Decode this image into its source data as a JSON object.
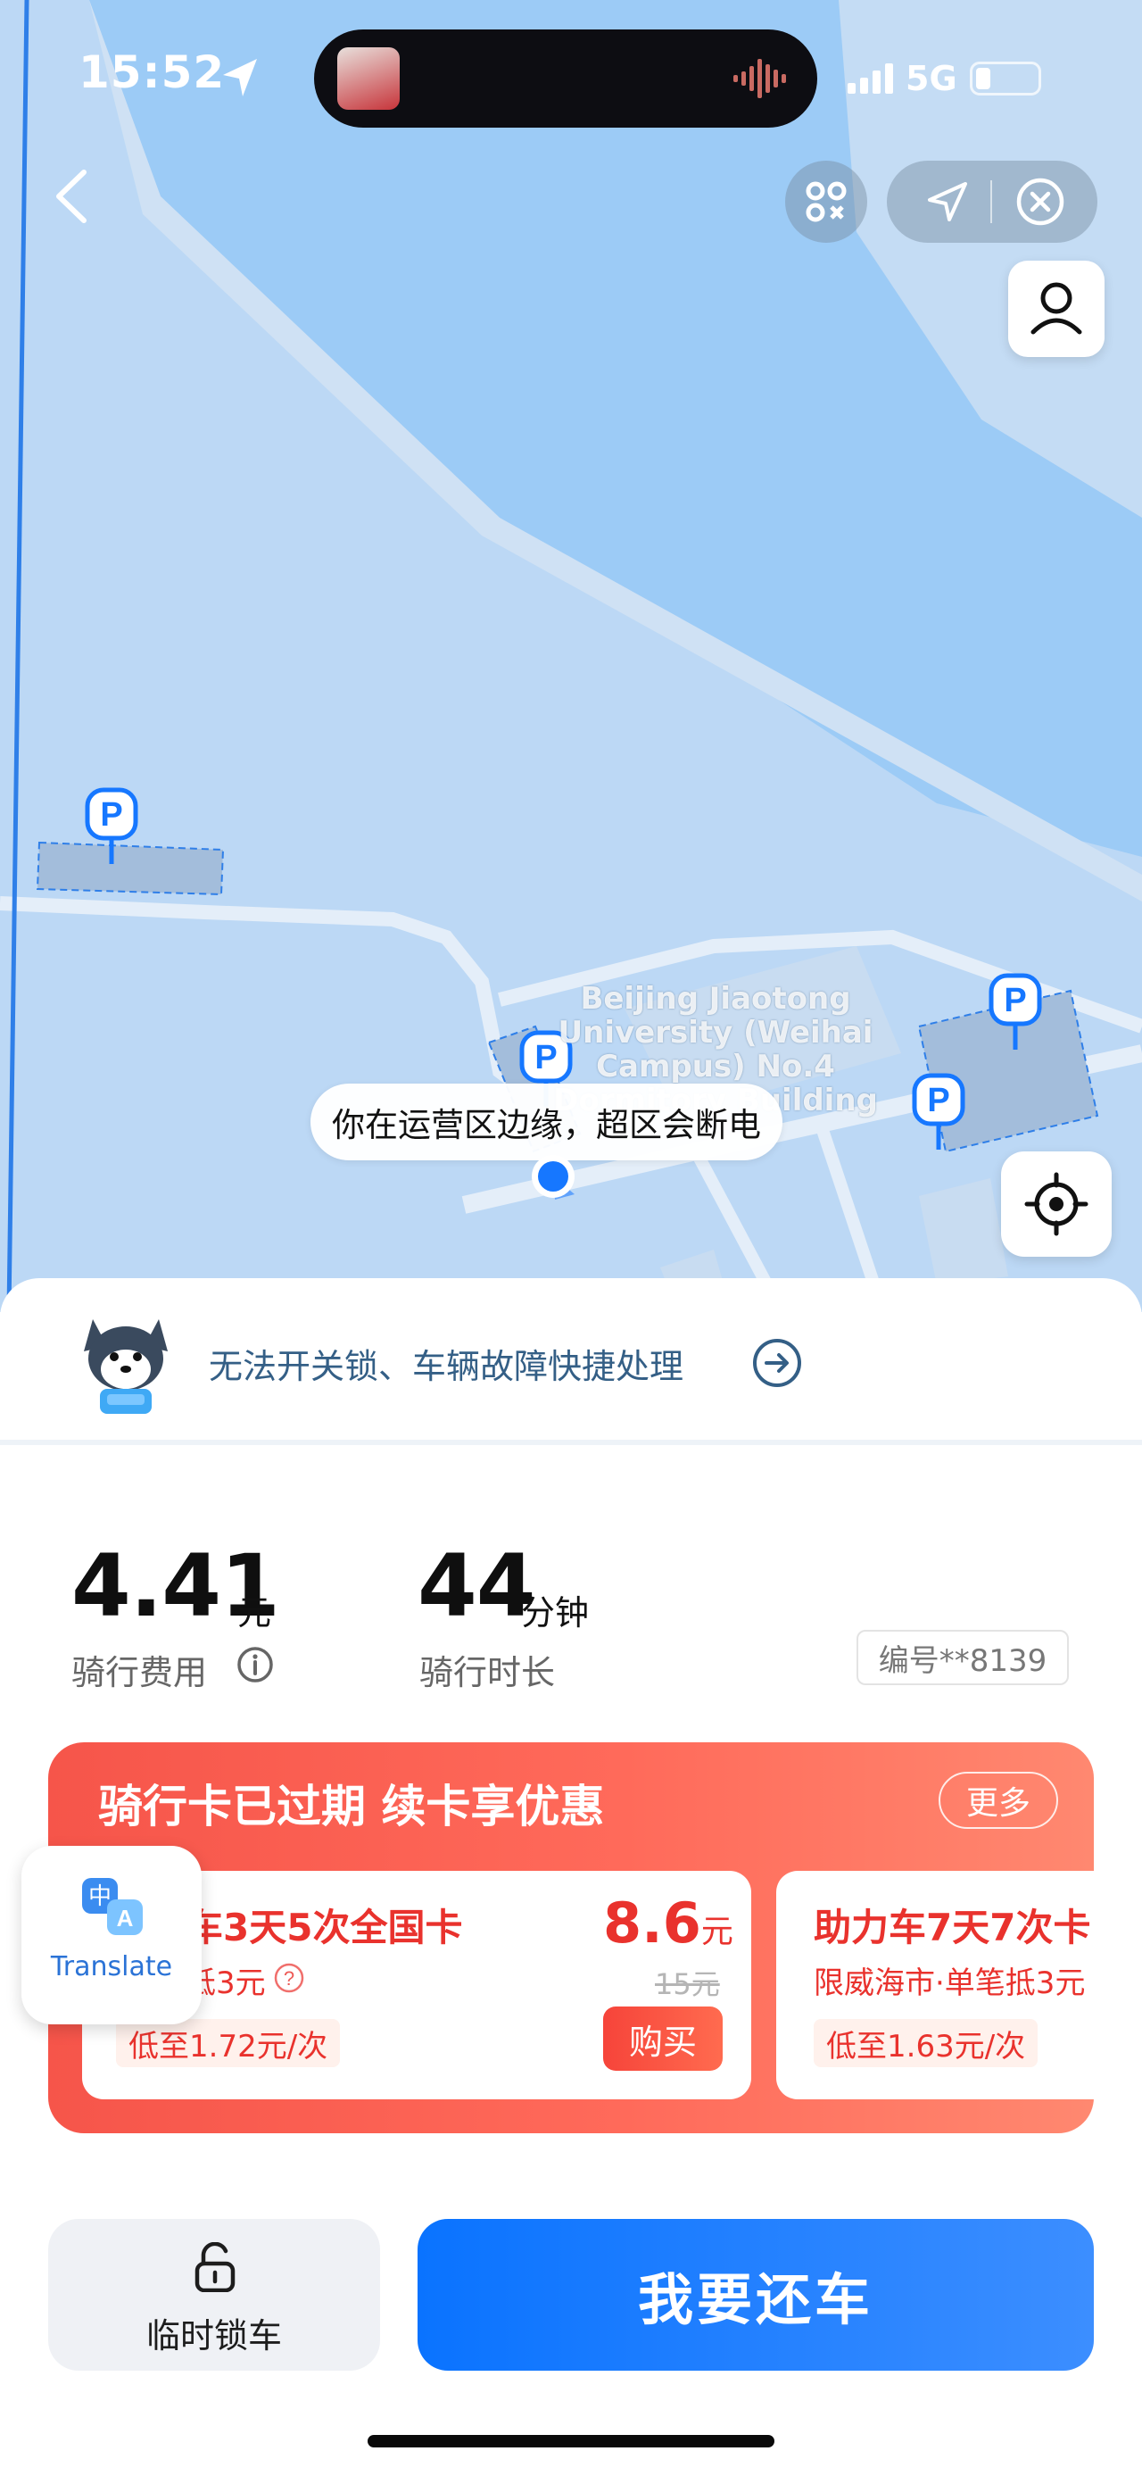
{
  "status_bar": {
    "time": "15:52",
    "network": "5G"
  },
  "map": {
    "campus_label": [
      "Beijing Jiaotong",
      "University (Weihai",
      "Campus) No.4",
      "Dormitory Building"
    ],
    "edge_warning": "你在运营区边缘，超区会断电",
    "parking_marker": "P"
  },
  "help_bar": {
    "text": "无法开关锁、车辆故障快捷处理"
  },
  "trip": {
    "fee_value": "4.41",
    "fee_unit": "元",
    "fee_label": "骑行费用",
    "duration_value": "44",
    "duration_unit": "分钟",
    "duration_label": "骑行时长",
    "serial": "编号**8139"
  },
  "promo": {
    "title": "骑行卡已过期 续卡享优惠",
    "more_label": "更多",
    "cards": [
      {
        "name": "车3天5次全国卡",
        "sub": "抵3元",
        "tag": "低至1.72元/次",
        "price": "8.6",
        "price_unit": "元",
        "old_price": "15元",
        "buy_label": "购买"
      },
      {
        "name": "助力车7天7次卡",
        "sub": "限威海市·单笔抵3元",
        "tag": "低至1.63元/次"
      }
    ]
  },
  "translate": {
    "label": "Translate",
    "glyph_zh": "中",
    "glyph_a": "A"
  },
  "actions": {
    "lock_label": "临时锁车",
    "return_label": "我要还车"
  },
  "colors": {
    "accent_blue": "#0a73ff",
    "promo_red": "#f6554a",
    "price_red": "#e9322d",
    "map_blue": "#bcd8f5"
  }
}
